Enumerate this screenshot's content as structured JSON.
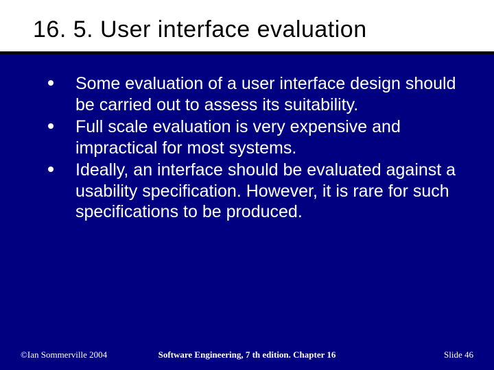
{
  "title": "16. 5. User interface evaluation",
  "bullets": [
    "Some evaluation of a user interface design should be carried out to assess its suitability.",
    "Full scale evaluation is very expensive and impractical for most systems.",
    "Ideally, an interface should be evaluated against a usability specification. However, it is rare for such specifications to be produced."
  ],
  "footer": {
    "left": "©Ian Sommerville 2004",
    "center": "Software Engineering, 7 th edition. Chapter 16",
    "right": "Slide 46"
  }
}
